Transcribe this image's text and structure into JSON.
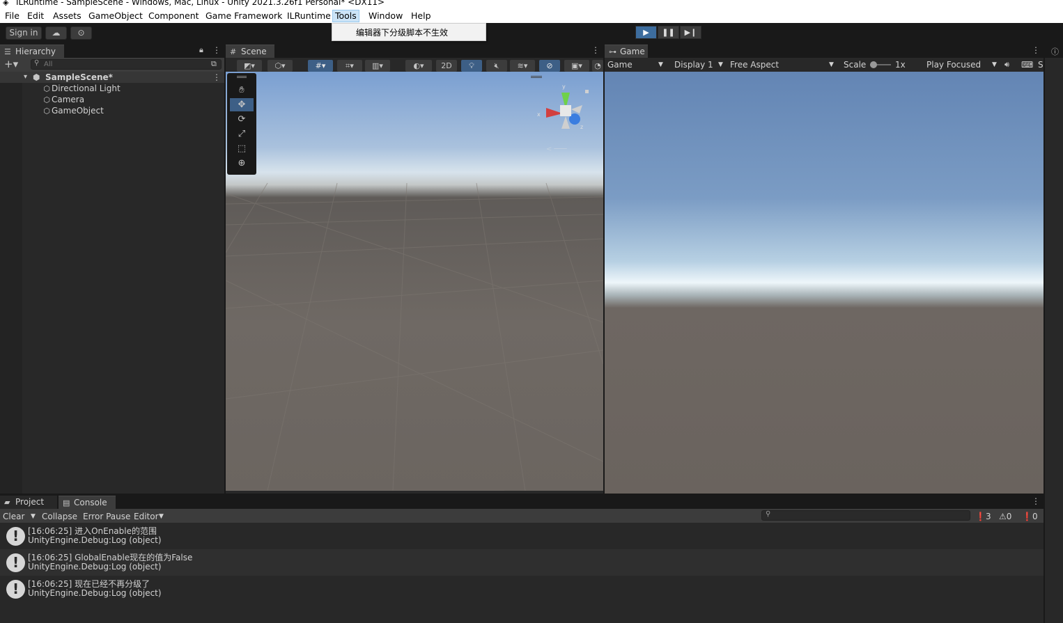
{
  "window": {
    "title": "ILRuntime - SampleScene - Windows, Mac, Linux - Unity 2021.3.26f1 Personal* <DX11>"
  },
  "menu": {
    "items": [
      "File",
      "Edit",
      "Assets",
      "GameObject",
      "Component",
      "Game Framework",
      "ILRuntime",
      "Tools",
      "Window",
      "Help"
    ],
    "active": "Tools",
    "dropdown_item": "编辑器下分级脚本不生效"
  },
  "toolbar": {
    "sign_in": "Sign in"
  },
  "hierarchy": {
    "tab": "Hierarchy",
    "search_placeholder": "All",
    "scene": "SampleScene*",
    "objects": [
      "Directional Light",
      "Camera",
      "GameObject"
    ]
  },
  "scene": {
    "tab": "Scene",
    "btn_2d": "2D",
    "axis_x": "x",
    "axis_y": "y",
    "axis_z": "z"
  },
  "game": {
    "tab": "Game",
    "mode": "Game",
    "display": "Display 1",
    "aspect": "Free Aspect",
    "scale_label": "Scale",
    "scale_value": "1x",
    "play_mode": "Play Focused",
    "trailing": "S"
  },
  "bottom": {
    "tab_project": "Project",
    "tab_console": "Console",
    "clear": "Clear",
    "collapse": "Collapse",
    "error_pause": "Error Pause",
    "editor": "Editor",
    "log_count": "3",
    "warn_count": "0",
    "error_count": "0",
    "logs": [
      {
        "message": "[16:06:25] 进入OnEnable的范围",
        "source": "UnityEngine.Debug:Log (object)"
      },
      {
        "message": "[16:06:25] GlobalEnable现在的值为False",
        "source": "UnityEngine.Debug:Log (object)"
      },
      {
        "message": "[16:06:25] 现在已经不再分级了",
        "source": "UnityEngine.Debug:Log (object)"
      }
    ]
  },
  "colors": {
    "accent": "#3d6d9e",
    "panel": "#282828",
    "toolbar": "#191919"
  }
}
